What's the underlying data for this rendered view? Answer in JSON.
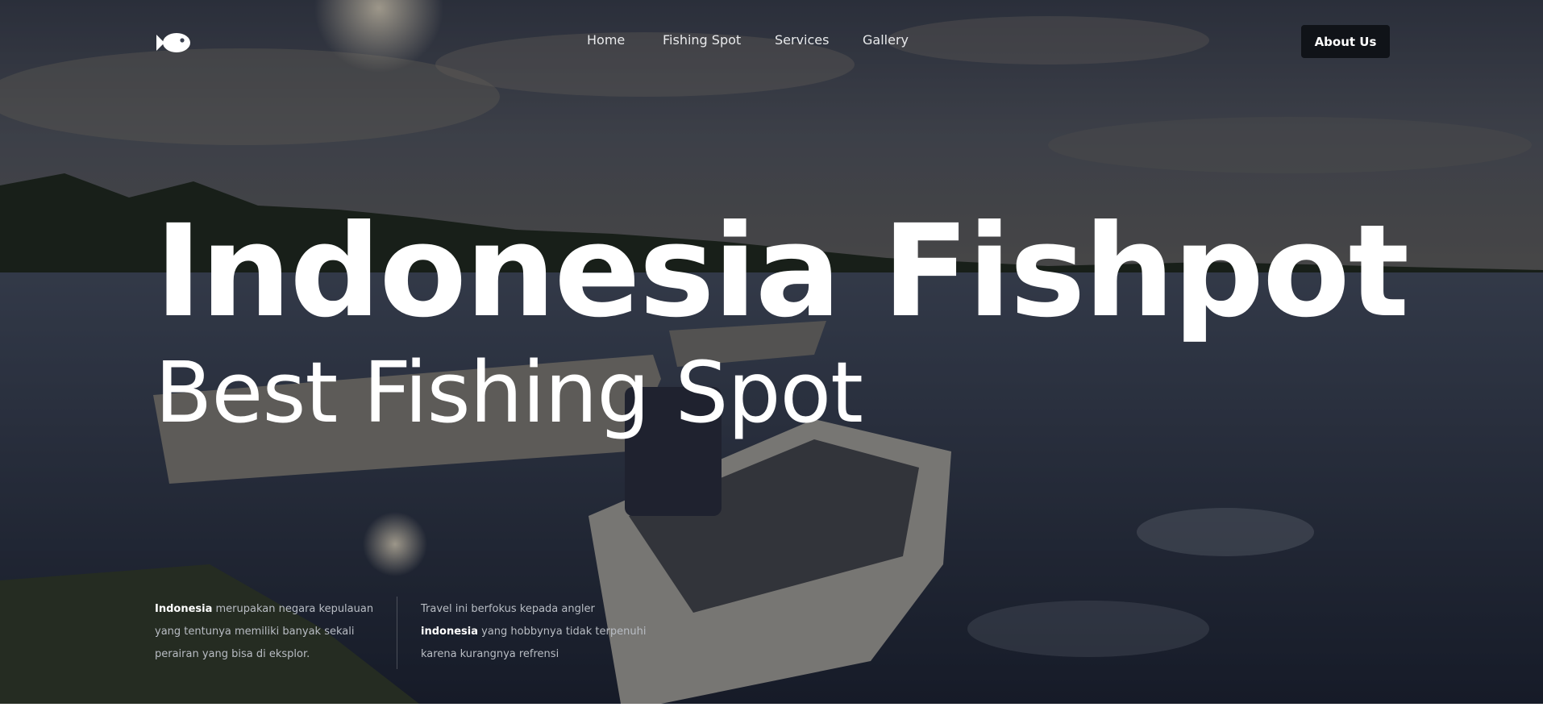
{
  "nav": {
    "logo_icon": "fish-icon",
    "links": [
      {
        "label": "Home"
      },
      {
        "label": "Fishing Spot"
      },
      {
        "label": "Services"
      },
      {
        "label": "Gallery"
      }
    ],
    "cta_label": "About Us"
  },
  "hero": {
    "title": "Indonesia Fishpot",
    "subtitle": "Best Fishing Spot"
  },
  "descriptions": {
    "left": {
      "bold": "Indonesia",
      "text": " merupakan negara kepulauan yang tentunya memiliki banyak sekali perairan yang bisa di eksplor."
    },
    "right": {
      "text": "Travel ini berfokus kepada angler ",
      "bold": "indonesia",
      "text2": " yang hobbynya tidak terpenuhi karena kurangnya refrensi"
    }
  },
  "colors": {
    "accent": "#101318",
    "text_primary": "#ffffff",
    "text_muted": "#b9bdc4"
  }
}
